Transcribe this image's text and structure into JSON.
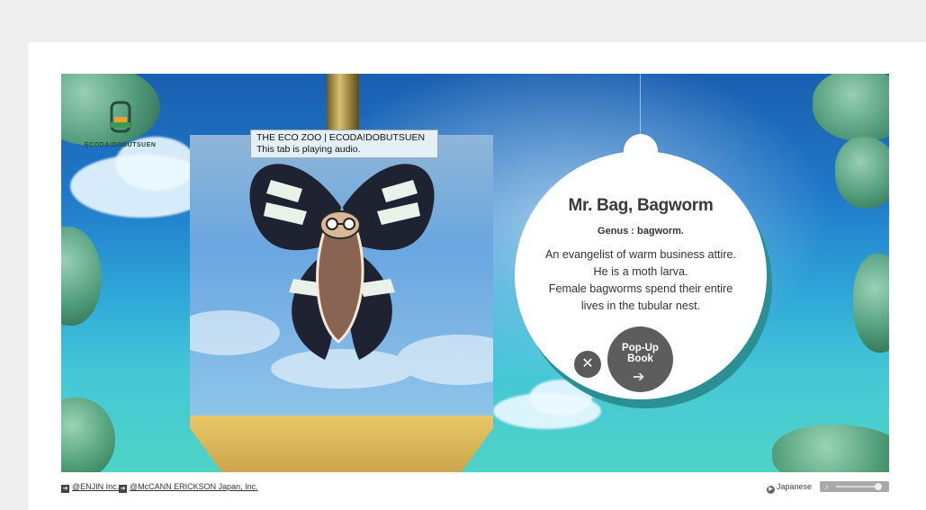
{
  "tooltip": {
    "title": "THE ECO ZOO | ECODA!DOBUTSUEN",
    "subtitle": "This tab is playing audio."
  },
  "logo": {
    "text": "ECODA!DOBUTSUEN"
  },
  "info": {
    "title": "Mr. Bag, Bagworm",
    "genus": "Genus : bagworm.",
    "description": [
      "An evangelist of warm business attire.",
      "He is a moth larva.",
      "Female bagworms spend their entire",
      "lives in the tubular nest."
    ]
  },
  "buttons": {
    "close_symbol": "✕",
    "popup_line1": "Pop-Up",
    "popup_line2": "Book"
  },
  "footer": {
    "link1": "@ENJIN Inc.",
    "link2": "@McCANN ERICKSON Japan, Inc.",
    "language": "Japanese"
  },
  "colors": {
    "sky_top": "#1a5fb0",
    "sky_bottom": "#4fd3c7",
    "button_dark": "#5d5d5d",
    "bubble_shadow": "#2c8f93"
  }
}
